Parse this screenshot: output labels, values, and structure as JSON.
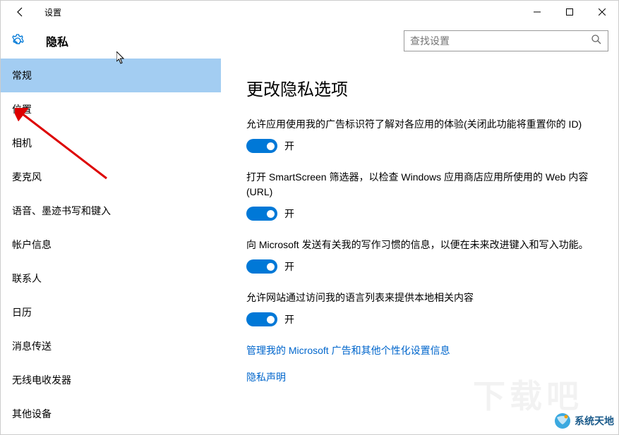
{
  "titlebar": {
    "title": "设置"
  },
  "header": {
    "title": "隐私",
    "search_placeholder": "查找设置"
  },
  "sidebar": {
    "items": [
      {
        "label": "常规",
        "selected": true
      },
      {
        "label": "位置",
        "selected": false
      },
      {
        "label": "相机",
        "selected": false
      },
      {
        "label": "麦克风",
        "selected": false
      },
      {
        "label": "语音、墨迹书写和键入",
        "selected": false
      },
      {
        "label": "帐户信息",
        "selected": false
      },
      {
        "label": "联系人",
        "selected": false
      },
      {
        "label": "日历",
        "selected": false
      },
      {
        "label": "消息传送",
        "selected": false
      },
      {
        "label": "无线电收发器",
        "selected": false
      },
      {
        "label": "其他设备",
        "selected": false
      }
    ]
  },
  "content": {
    "title": "更改隐私选项",
    "settings": [
      {
        "desc": "允许应用使用我的广告标识符了解对各应用的体验(关闭此功能将重置你的 ID)",
        "state": "开"
      },
      {
        "desc": "打开 SmartScreen 筛选器，以检查 Windows 应用商店应用所使用的 Web 内容(URL)",
        "state": "开"
      },
      {
        "desc": "向 Microsoft 发送有关我的写作习惯的信息，以便在未来改进键入和写入功能。",
        "state": "开"
      },
      {
        "desc": "允许网站通过访问我的语言列表来提供本地相关内容",
        "state": "开"
      }
    ],
    "links": [
      {
        "text": "管理我的 Microsoft 广告和其他个性化设置信息"
      },
      {
        "text": "隐私声明"
      }
    ]
  },
  "watermark": {
    "text": "系统天地",
    "bg": "下载吧"
  }
}
